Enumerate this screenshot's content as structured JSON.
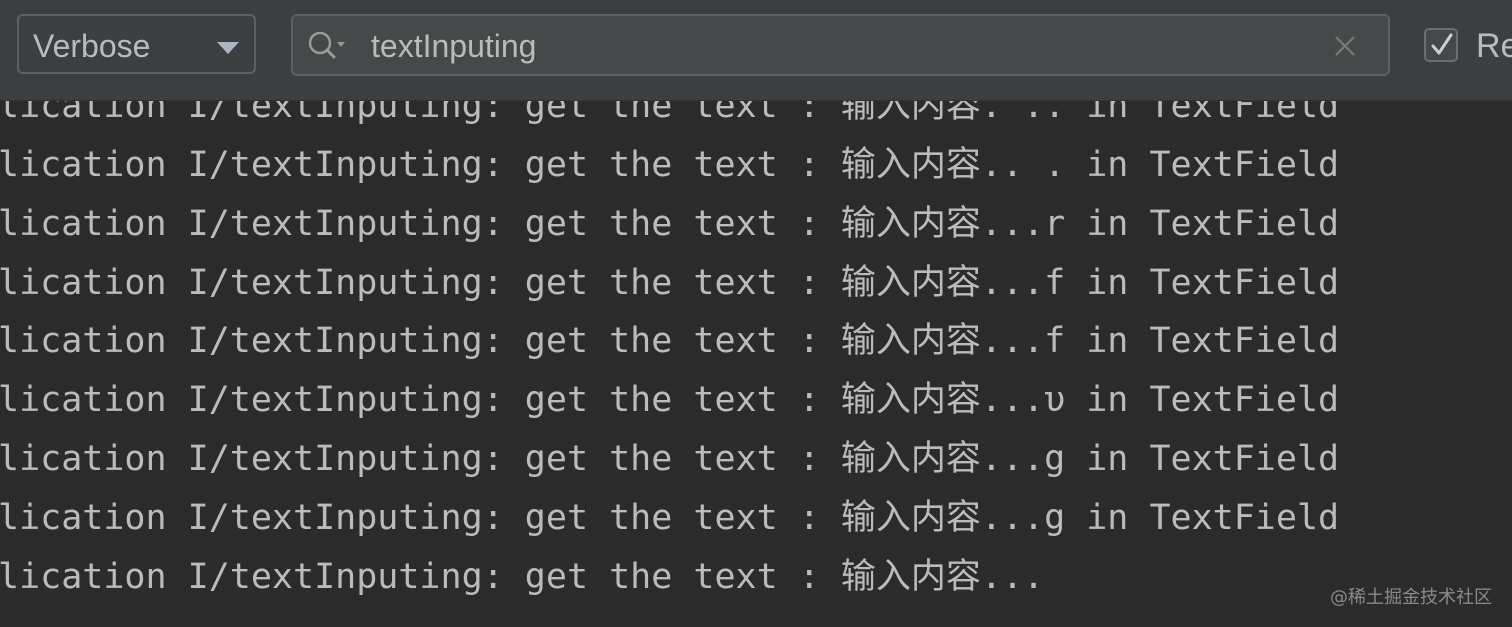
{
  "toolbar": {
    "log_level": "Verbose",
    "search_value": "textInputing",
    "regex_checked": true,
    "regex_label": "Re"
  },
  "log_lines": [
    "lication I/textInputing: get the text : 输入内容. .. in TextField",
    "lication I/textInputing: get the text : 输入内容.. . in TextField",
    "lication I/textInputing: get the text : 输入内容...r in TextField",
    "lication I/textInputing: get the text : 输入内容...f in TextField",
    "lication I/textInputing: get the text : 输入内容...f in TextField",
    "lication I/textInputing: get the text : 输入内容...υ in TextField",
    "lication I/textInputing: get the text : 输入内容...g in TextField",
    "lication I/textInputing: get the text : 输入内容...g in TextField",
    "lication I/textInputing: get the text : 输入内容..."
  ],
  "watermark": "@稀土掘金技术社区",
  "colors": {
    "background": "#2b2b2b",
    "toolbar": "#3c3f41",
    "text": "#bbbbbb"
  }
}
